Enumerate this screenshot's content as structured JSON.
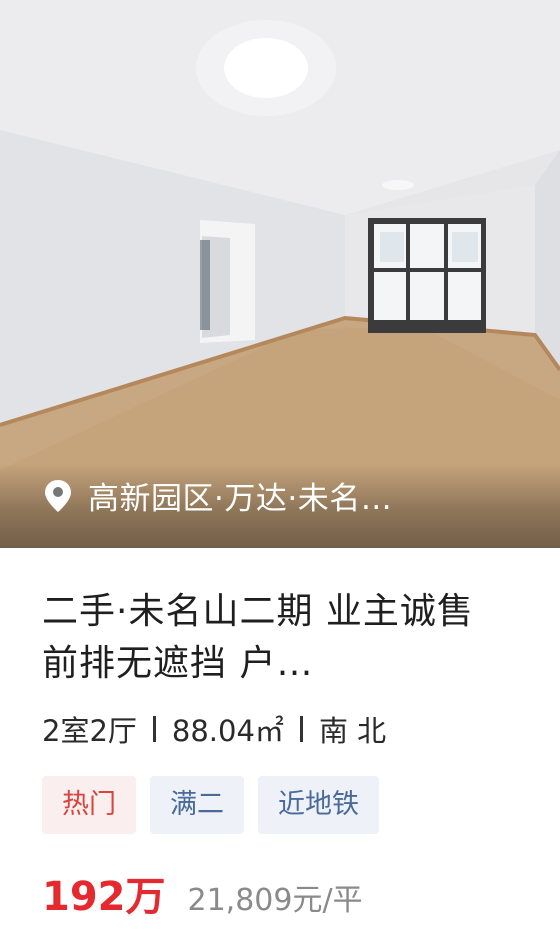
{
  "listing": {
    "location": "高新园区·万达·未名…",
    "title": "二手·未名山二期 业主诚售 前排无遮挡 户…",
    "layout": "2室2厅",
    "area": "88.04㎡",
    "orientation": "南 北",
    "tags": [
      "热门",
      "满二",
      "近地铁"
    ],
    "price": "192万",
    "unit_price": "21,809元/平"
  },
  "icons": {
    "location": "map-pin-icon"
  },
  "colors": {
    "price": "#e4292f",
    "hot_tag_text": "#d9443f",
    "hot_tag_bg": "#fbeeee",
    "tag_text": "#4a6a9a",
    "tag_bg": "#eef2f8"
  }
}
